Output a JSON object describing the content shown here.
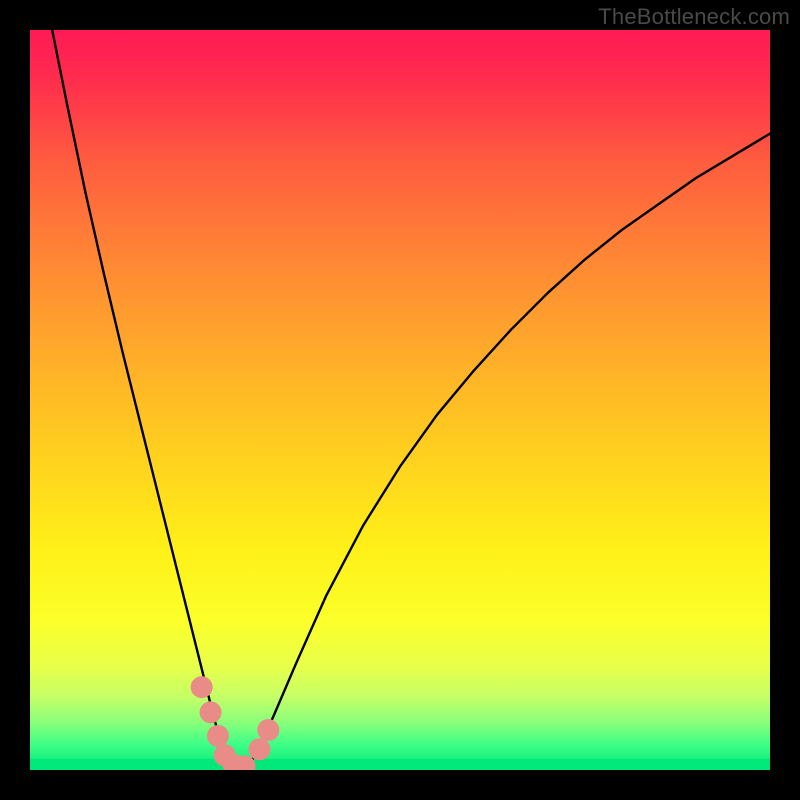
{
  "watermark": "TheBottleneck.com",
  "chart_data": {
    "type": "line",
    "title": "",
    "xlabel": "",
    "ylabel": "",
    "xlim": [
      0,
      100
    ],
    "ylim": [
      0,
      100
    ],
    "grid": false,
    "legend": false,
    "background_gradient": {
      "stops": [
        {
          "offset": 0.0,
          "color": "#ff1a55"
        },
        {
          "offset": 0.06,
          "color": "#ff2a4e"
        },
        {
          "offset": 0.18,
          "color": "#ff5d3f"
        },
        {
          "offset": 0.32,
          "color": "#ff8a34"
        },
        {
          "offset": 0.46,
          "color": "#ffb228"
        },
        {
          "offset": 0.58,
          "color": "#ffd21e"
        },
        {
          "offset": 0.7,
          "color": "#fff018"
        },
        {
          "offset": 0.8,
          "color": "#fbff2a"
        },
        {
          "offset": 0.86,
          "color": "#e8ff4a"
        },
        {
          "offset": 0.9,
          "color": "#c6ff66"
        },
        {
          "offset": 0.935,
          "color": "#8bff7a"
        },
        {
          "offset": 0.965,
          "color": "#3fff86"
        },
        {
          "offset": 1.0,
          "color": "#00e87a"
        }
      ]
    },
    "series": [
      {
        "name": "left-branch",
        "x": [
          3.0,
          5.0,
          7.5,
          10.0,
          12.5,
          15.0,
          17.0,
          19.0,
          20.5,
          22.0,
          23.0,
          24.0,
          25.0,
          26.0,
          27.0,
          28.0
        ],
        "y": [
          100.0,
          90.0,
          78.0,
          67.0,
          56.5,
          46.5,
          38.5,
          30.5,
          24.5,
          18.5,
          14.5,
          10.5,
          6.5,
          3.5,
          1.5,
          0.5
        ]
      },
      {
        "name": "right-branch",
        "x": [
          29.5,
          31.0,
          33.0,
          36.0,
          40.0,
          45.0,
          50.0,
          55.0,
          60.0,
          65.0,
          70.0,
          75.0,
          80.0,
          85.0,
          90.0,
          95.0,
          100.0
        ],
        "y": [
          0.5,
          3.0,
          7.5,
          14.5,
          23.5,
          33.0,
          41.0,
          48.0,
          54.0,
          59.5,
          64.5,
          69.0,
          73.0,
          76.5,
          80.0,
          83.0,
          86.0
        ]
      }
    ],
    "markers": [
      {
        "x": 23.2,
        "y": 11.2
      },
      {
        "x": 24.4,
        "y": 7.8
      },
      {
        "x": 25.4,
        "y": 4.6
      },
      {
        "x": 26.3,
        "y": 2.0
      },
      {
        "x": 27.5,
        "y": 0.7
      },
      {
        "x": 29.0,
        "y": 0.5
      },
      {
        "x": 31.0,
        "y": 2.8
      },
      {
        "x": 32.2,
        "y": 5.4
      }
    ],
    "marker_style": {
      "color": "#e98b86",
      "radius_px": 11
    },
    "band": {
      "y0": 0.0,
      "y1": 1.5,
      "color": "#00e87a"
    }
  }
}
